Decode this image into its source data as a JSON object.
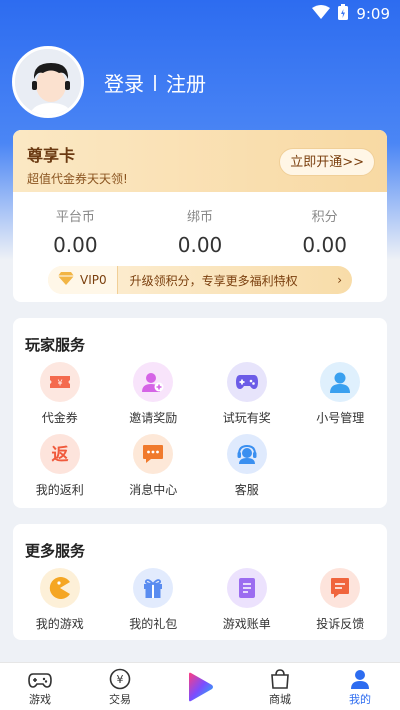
{
  "status": {
    "time": "9:09"
  },
  "auth": {
    "login": "登录",
    "register": "注册"
  },
  "vip": {
    "title": "尊享卡",
    "subtitle": "超值代金券天天领!",
    "open_button": "立即开通>>",
    "level": "VIP0",
    "promo": "升级领积分，专享更多福利特权",
    "arrow": "›"
  },
  "stats": [
    {
      "label": "平台币",
      "value": "0.00"
    },
    {
      "label": "绑币",
      "value": "0.00"
    },
    {
      "label": "积分",
      "value": "0.00"
    }
  ],
  "player_services": {
    "title": "玩家服务",
    "items": [
      {
        "label": "代金券",
        "icon": "voucher-icon",
        "color": "#f46a4e",
        "bg": "#fde7e0"
      },
      {
        "label": "邀请奖励",
        "icon": "invite-user-icon",
        "color": "#d564e6",
        "bg": "#f8e4fb"
      },
      {
        "label": "试玩有奖",
        "icon": "gamepad-icon",
        "color": "#6c5ce7",
        "bg": "#e7e4fb"
      },
      {
        "label": "小号管理",
        "icon": "account-icon",
        "color": "#3aa0ef",
        "bg": "#dff0fd"
      },
      {
        "label": "我的返利",
        "icon": "rebate-icon",
        "color": "#f05a3c",
        "bg": "#fde4dc",
        "glyph": "返"
      },
      {
        "label": "消息中心",
        "icon": "message-icon",
        "color": "#f07a2c",
        "bg": "#fde8d8"
      },
      {
        "label": "客服",
        "icon": "customer-service-icon",
        "color": "#3a8ff0",
        "bg": "#dfeafd"
      }
    ]
  },
  "more_services": {
    "title": "更多服务",
    "items": [
      {
        "label": "我的游戏",
        "icon": "my-game-icon",
        "color": "#f5a623",
        "bg": "#fdf0d8"
      },
      {
        "label": "我的礼包",
        "icon": "gift-icon",
        "color": "#5a8cf0",
        "bg": "#e2ebfd"
      },
      {
        "label": "游戏账单",
        "icon": "bill-icon",
        "color": "#9b6cf0",
        "bg": "#ece2fd"
      },
      {
        "label": "投诉反馈",
        "icon": "feedback-icon",
        "color": "#f0643c",
        "bg": "#fde4dc"
      }
    ]
  },
  "tabs": [
    {
      "label": "游戏",
      "icon": "game-tab-icon"
    },
    {
      "label": "交易",
      "icon": "trade-tab-icon"
    },
    {
      "label": "",
      "icon": "play-tab-icon"
    },
    {
      "label": "商城",
      "icon": "mall-tab-icon"
    },
    {
      "label": "我的",
      "icon": "mine-tab-icon"
    }
  ],
  "colors": {
    "primary": "#2d6cf0",
    "gold": "#7a3f0e"
  }
}
